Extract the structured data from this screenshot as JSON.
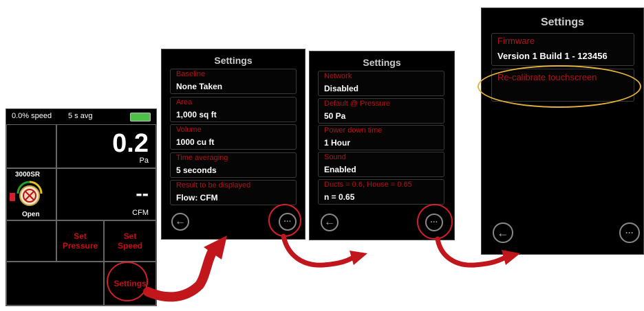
{
  "main": {
    "status_speed": "0.0% speed",
    "status_avg": "5 s avg",
    "pressure_value": "0.2",
    "pressure_unit": "Pa",
    "device_name": "3000SR",
    "device_state": "Open",
    "flow_value": "--",
    "flow_unit": "CFM",
    "set_pressure": "Set\nPressure",
    "set_speed": "Set\nSpeed",
    "settings_button": "Settings",
    "battery_color": "#4fc04a"
  },
  "panel1": {
    "title": "Settings",
    "items": [
      {
        "label": "Baseline",
        "value": "None Taken"
      },
      {
        "label": "Area",
        "value": "1,000 sq ft"
      },
      {
        "label": "Volume",
        "value": "1000 cu ft"
      },
      {
        "label": "Time averaging",
        "value": "5 seconds"
      },
      {
        "label": "Result to be displayed",
        "value": "Flow: CFM"
      }
    ]
  },
  "panel2": {
    "title": "Settings",
    "items": [
      {
        "label": "Network",
        "value": "Disabled"
      },
      {
        "label": "Default @ Pressure",
        "value": "50 Pa"
      },
      {
        "label": "Power down time",
        "value": "1 Hour"
      },
      {
        "label": "Sound",
        "value": "Enabled"
      },
      {
        "label": "Ducts = 0.6, House = 0.65",
        "value": "n = 0.65"
      }
    ]
  },
  "panel3": {
    "title": "Settings",
    "firmware_label": "Firmware",
    "firmware_value": "Version 1 Build 1 - 123456",
    "recalibrate_label": "Re-calibrate touchscreen"
  },
  "glyphs": {
    "back": "←",
    "more": "···"
  },
  "colors": {
    "accent_red": "#c40f16",
    "highlight_ring": "#d3202a",
    "callout_ellipse": "#e6b43a"
  }
}
